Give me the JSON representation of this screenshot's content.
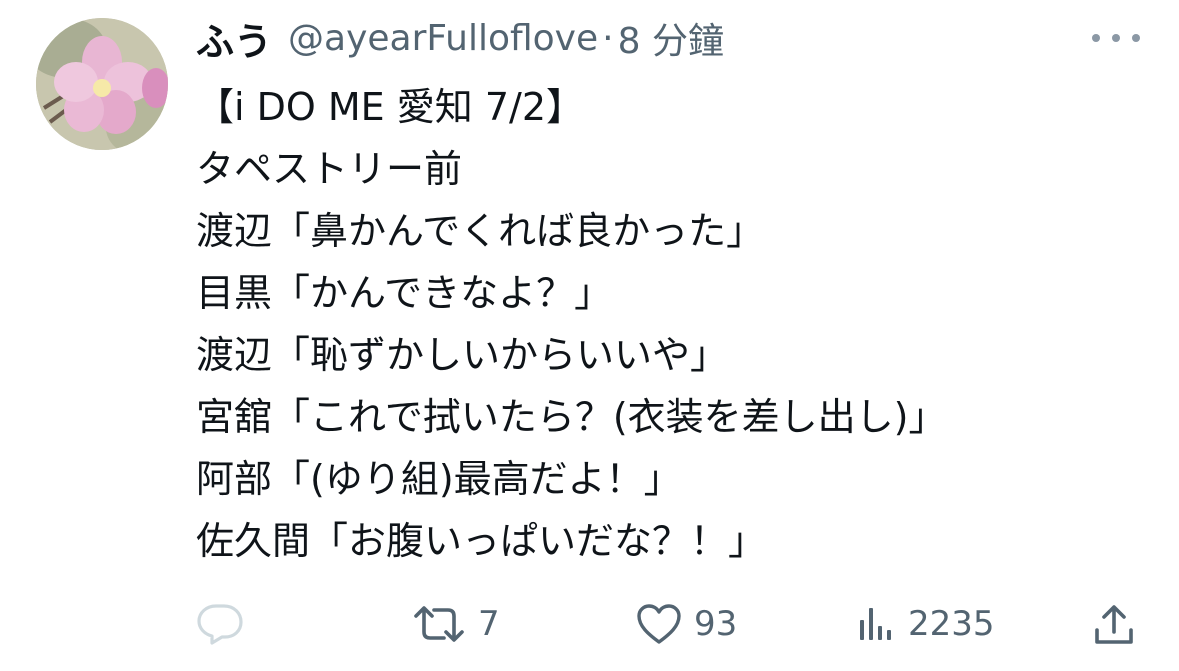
{
  "tweet": {
    "display_name": "ふう",
    "handle": "@ayearFulloflove",
    "separator": "·",
    "time": "8 分鐘",
    "lines": [
      "【i DO ME 愛知 7/2】",
      "タペストリー前",
      "渡辺「鼻かんでくれば良かった」",
      "目黒「かんできなよ？」",
      "渡辺「恥ずかしいからいいや」",
      "宮舘「これで拭いたら？(衣装を差し出し)」",
      "阿部「(ゆり組)最高だよ！」",
      "佐久間「お腹いっぱいだな？！」"
    ]
  },
  "actions": {
    "reply_icon": "reply-icon",
    "retweet_icon": "retweet-icon",
    "retweet_count": "7",
    "like_icon": "heart-icon",
    "like_count": "93",
    "views_icon": "views-chart-icon",
    "views_count": "2235",
    "share_icon": "share-icon"
  },
  "colors": {
    "text_primary": "#0f1419",
    "text_secondary": "#536471",
    "icon_gray": "#536471"
  }
}
